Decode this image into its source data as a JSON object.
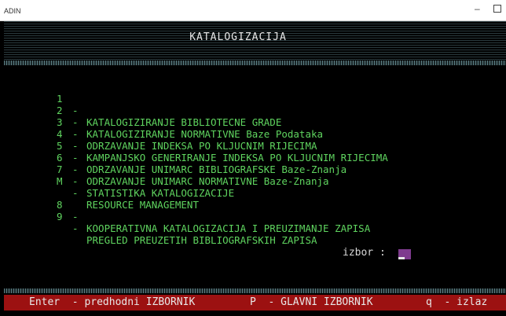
{
  "window": {
    "app_title": "ADIN",
    "minimize_glyph": "–"
  },
  "screen": {
    "title": "KATALOGIZACIJA"
  },
  "menu": [
    {
      "key": "1",
      "label": "KATALOGIZIRANJE BIBLIOTECNE GRADE"
    },
    {
      "key": "2",
      "label": "KATALOGIZIRANJE NORMATIVNE Baze Podataka"
    },
    {
      "key": "3",
      "label": "ODRZAVANJE INDEKSA PO KLJUCNIM RIJECIMA"
    },
    {
      "key": "4",
      "label": "KAMPANJSKO GENERIRANJE INDEKSA PO KLJUCNIM RIJECIMA"
    },
    {
      "key": "5",
      "label": "ODRZAVANJE UNIMARC BIBLIOGRAFSKE Baze-Znanja"
    },
    {
      "key": "6",
      "label": "ODRZAVANJE UNIMARC NORMATIVNE Baze-Znanja"
    },
    {
      "key": "7",
      "label": "STATISTIKA KATALOGIZACIJE"
    },
    {
      "key": "M",
      "label": "RESOURCE MANAGEMENT"
    },
    {
      "key": "8",
      "label": "KOOPERATIVNA KATALOGIZACIJA I PREUZIMANJE ZAPISA"
    },
    {
      "key": "9",
      "label": "PREGLED PREUZETIH BIBLIOGRAFSKIH ZAPISA"
    }
  ],
  "separator": "-",
  "prompt": {
    "label": "izbor :"
  },
  "status": {
    "enter": "Enter  - predhodni IZBORNIK",
    "p": "P  - GLAVNI IZBORNIK",
    "q": "q  - izlaz"
  },
  "colors": {
    "menu_text": "#5fd45f",
    "status_bar": "#9c1111",
    "cursor": "#7e3b8e"
  }
}
